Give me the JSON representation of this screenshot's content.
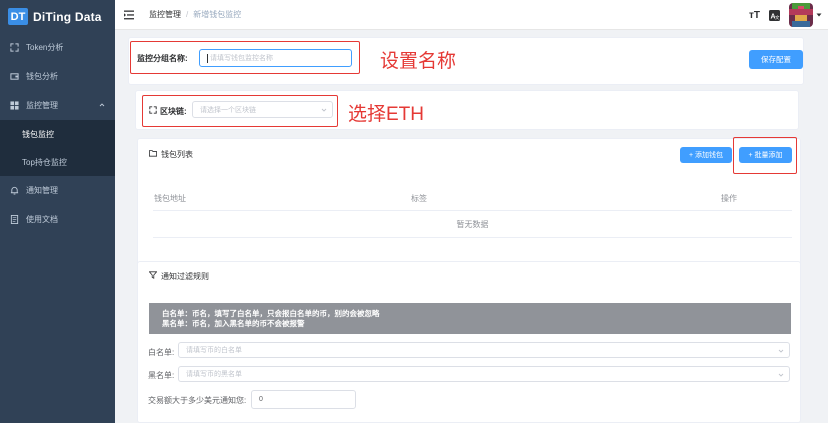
{
  "brand": {
    "logo": "DT",
    "name": "DiTing Data"
  },
  "sidebar": {
    "items": [
      {
        "label": "Token分析",
        "icon": "expand-icon"
      },
      {
        "label": "钱包分析",
        "icon": "wallet-icon"
      },
      {
        "label": "监控管理",
        "icon": "grid-icon",
        "expanded": true,
        "children": [
          {
            "label": "钱包监控",
            "active": true
          },
          {
            "label": "Top持仓监控"
          }
        ]
      },
      {
        "label": "通知管理",
        "icon": "bell-icon"
      },
      {
        "label": "使用文档",
        "icon": "document-icon"
      }
    ]
  },
  "header": {
    "breadcrumb": [
      "监控管理",
      "新增钱包监控"
    ],
    "font_size_icon": "тT",
    "lang_icon": "A文"
  },
  "form": {
    "group_name_label": "监控分组名称:",
    "group_name_placeholder": "请填写钱包监控名称",
    "save_button": "保存配置",
    "chain_label": "区块链:",
    "chain_placeholder": "请选择一个区块链"
  },
  "annotations": {
    "set_name": "设置名称",
    "choose_eth": "选择ETH"
  },
  "wallet_list": {
    "title": "钱包列表",
    "add_wallet": "+ 添加钱包",
    "batch_add": "+ 批量添加",
    "columns": [
      "钱包地址",
      "标签",
      "操作"
    ],
    "empty_text": "暂无数据"
  },
  "filter": {
    "title": "通知过滤规则",
    "notice_line1": "白名单：币名，填写了白名单，只会报白名单的币，别的会被忽略",
    "notice_line2": "黑名单：币名，加入黑名单的币不会被报警",
    "whitelist_label": "白名单:",
    "whitelist_placeholder": "请填写币的白名单",
    "blacklist_label": "黑名单:",
    "blacklist_placeholder": "请填写币的黑名单",
    "amount_label": "交易额大于多少美元通知您:",
    "amount_value": "0"
  },
  "colors": {
    "sidebar_bg": "#304156",
    "submenu_bg": "#1f2d3d",
    "primary": "#409eff",
    "annotation_red": "#e53935",
    "notice_bg": "#909399"
  }
}
